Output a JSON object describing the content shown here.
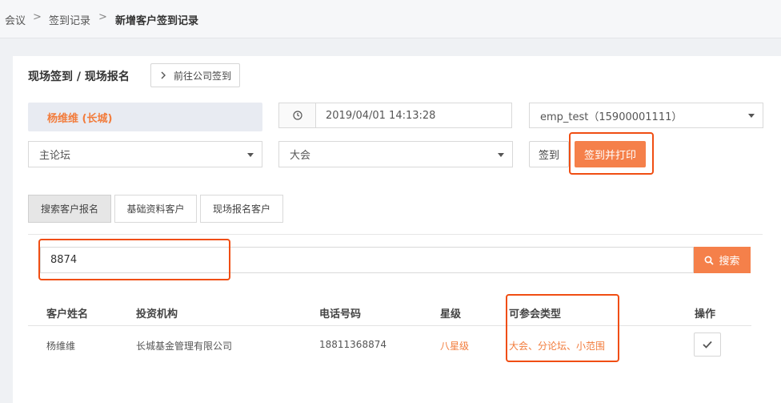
{
  "breadcrumb": {
    "items": [
      "会议",
      "签到记录",
      "新增客户签到记录"
    ],
    "separator": ">"
  },
  "section": {
    "title": "现场签到 / 现场报名",
    "goto_company_label": "前往公司签到",
    "goto_icon": "chevron-right-icon"
  },
  "form": {
    "customer_name": "杨维维 (长城)",
    "datetime": "2019/04/01 14:13:28",
    "employee": "emp_test（15900001111）",
    "forum": "主论坛",
    "meeting": "大会",
    "checkin_label": "签到",
    "checkin_print_label": "签到并打印"
  },
  "tabs": [
    {
      "label": "搜索客户报名",
      "active": true
    },
    {
      "label": "基础资料客户",
      "active": false
    },
    {
      "label": "现场报名客户",
      "active": false
    }
  ],
  "search": {
    "value": "8874",
    "button_label": "搜索"
  },
  "table": {
    "headers": [
      "客户姓名",
      "投资机构",
      "电话号码",
      "星级",
      "可参会类型",
      "操作"
    ],
    "rows": [
      {
        "name": "杨维维",
        "org": "长城基金管理有限公司",
        "phone": "18811368874",
        "star": "八星级",
        "types": "大会、分论坛、小范围"
      }
    ]
  },
  "colors": {
    "accent": "#f5804a",
    "highlight": "#f04e13",
    "orange_text": "#f27c3c"
  }
}
